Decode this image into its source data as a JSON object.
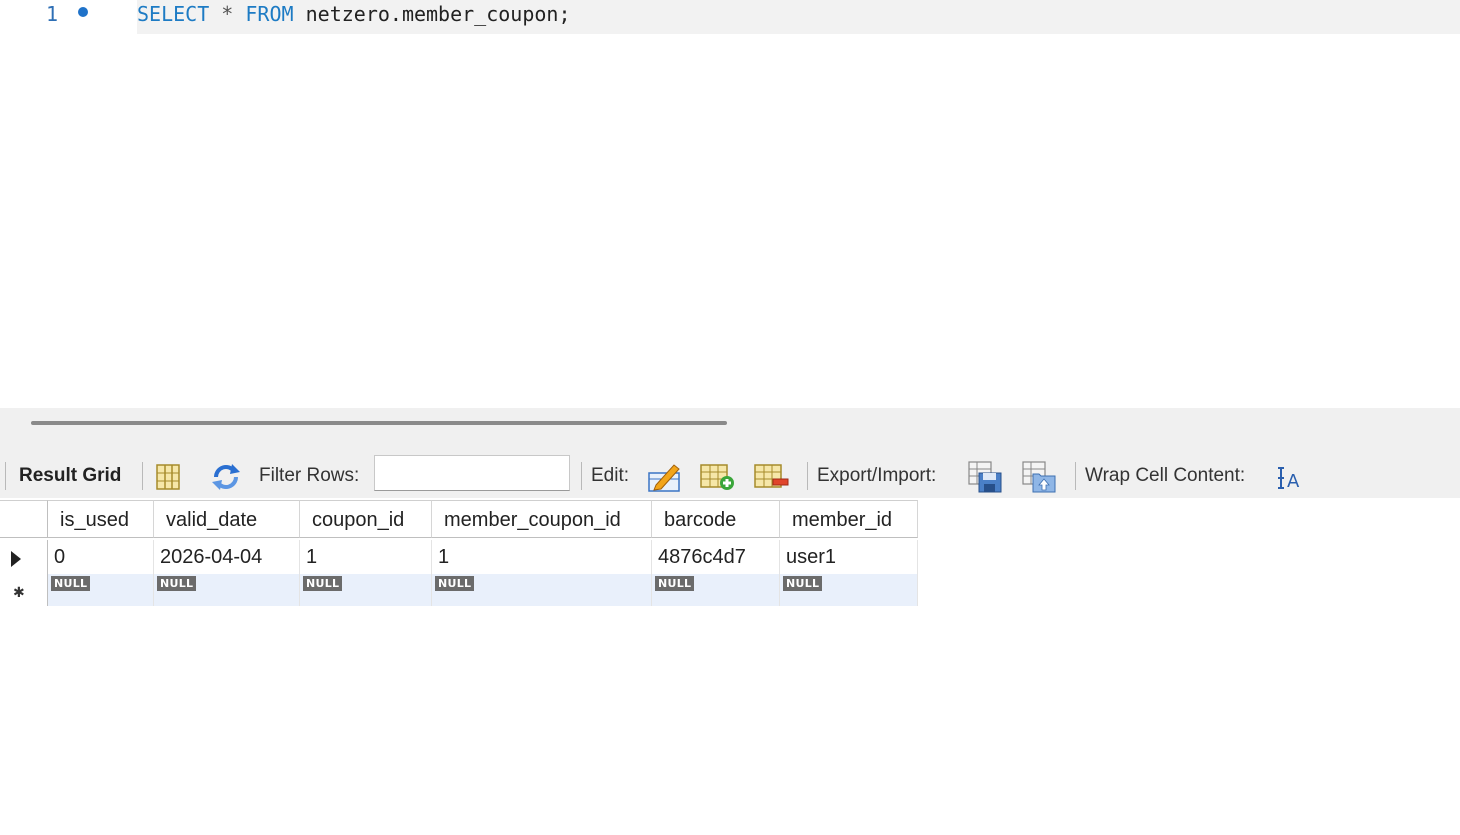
{
  "editor": {
    "line_number": "1",
    "sql": {
      "kw_select": "SELECT",
      "star": "*",
      "kw_from": "FROM",
      "rest": "netzero.member_coupon;"
    }
  },
  "toolbar": {
    "result_grid_label": "Result Grid",
    "filter_rows_label": "Filter Rows:",
    "filter_rows_value": "",
    "edit_label": "Edit:",
    "export_import_label": "Export/Import:",
    "wrap_cell_label": "Wrap Cell Content:",
    "icons": [
      "form-editor-icon",
      "refresh-icon",
      "edit-row-icon",
      "add-row-icon",
      "delete-row-icon",
      "export-icon",
      "import-icon",
      "wrap-text-icon"
    ]
  },
  "grid": {
    "columns": [
      "is_used",
      "valid_date",
      "coupon_id",
      "member_coupon_id",
      "barcode",
      "member_id"
    ],
    "rows": [
      [
        "0",
        "2026-04-04",
        "1",
        "1",
        "4876c4d7",
        "user1"
      ]
    ],
    "new_row": [
      "NULL",
      "NULL",
      "NULL",
      "NULL",
      "NULL",
      "NULL"
    ]
  },
  "colors": {
    "keyword": "#1d7bc4",
    "null_badge": "#6b6b6b",
    "selected_row": "#e9f0fb"
  }
}
